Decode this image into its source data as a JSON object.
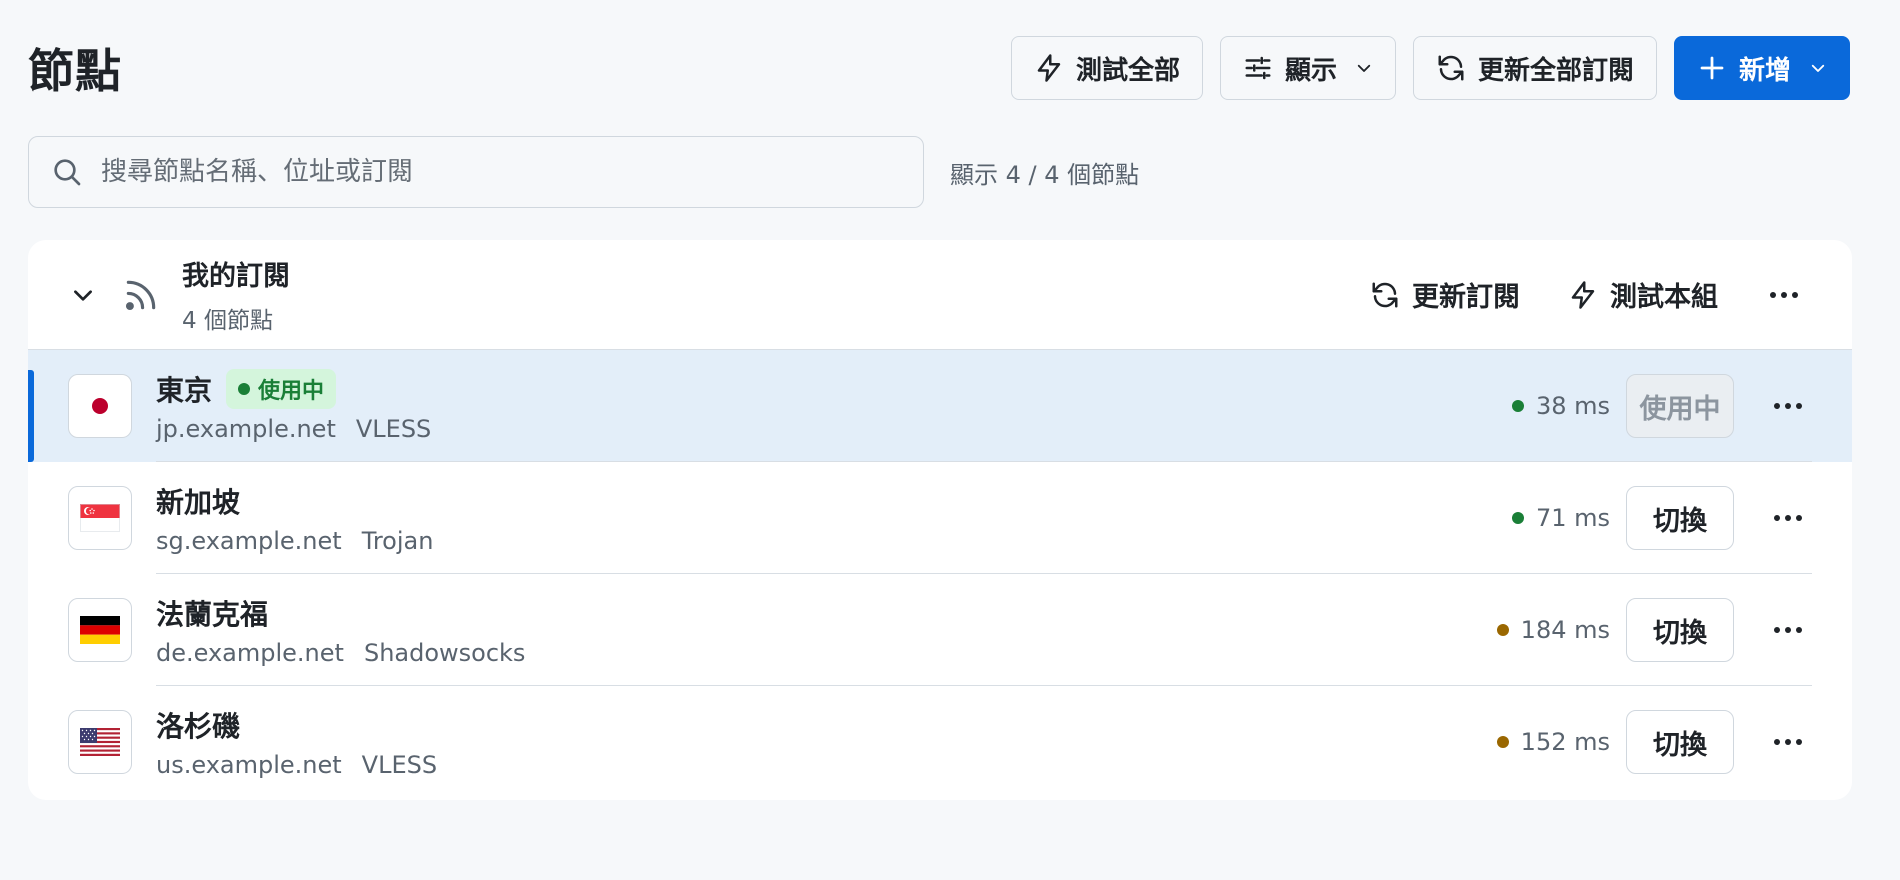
{
  "header": {
    "title": "節點",
    "test_all_label": "測試全部",
    "display_label": "顯示",
    "update_all_label": "更新全部訂閱",
    "add_label": "新增"
  },
  "search": {
    "placeholder": "搜尋節點名稱、位址或訂閱",
    "value": "",
    "count_text": "顯示 4 / 4 個節點"
  },
  "group": {
    "name": "我的訂閱",
    "count": "4 個節點",
    "update_label": "更新訂閱",
    "test_label": "測試本組"
  },
  "nodes": [
    {
      "name": "東京",
      "address": "jp.example.net",
      "protocol": "VLESS",
      "latency": "38 ms",
      "latency_color": "#1a7f37",
      "flag": "jp-flag-icon",
      "active": true,
      "badge": "使用中",
      "action_label": "使用中"
    },
    {
      "name": "新加坡",
      "address": "sg.example.net",
      "protocol": "Trojan",
      "latency": "71 ms",
      "latency_color": "#1a7f37",
      "flag": "sg-flag-icon",
      "active": false,
      "action_label": "切換"
    },
    {
      "name": "法蘭克福",
      "address": "de.example.net",
      "protocol": "Shadowsocks",
      "latency": "184 ms",
      "latency_color": "#9a6700",
      "flag": "de-flag-icon",
      "active": false,
      "action_label": "切換"
    },
    {
      "name": "洛杉磯",
      "address": "us.example.net",
      "protocol": "VLESS",
      "latency": "152 ms",
      "latency_color": "#9a6700",
      "flag": "us-flag-icon",
      "active": false,
      "action_label": "切換"
    }
  ],
  "colors": {
    "accent": "#0a69da",
    "active_row": "#e3eef9",
    "success": "#1a7f37",
    "warning": "#9a6700"
  }
}
